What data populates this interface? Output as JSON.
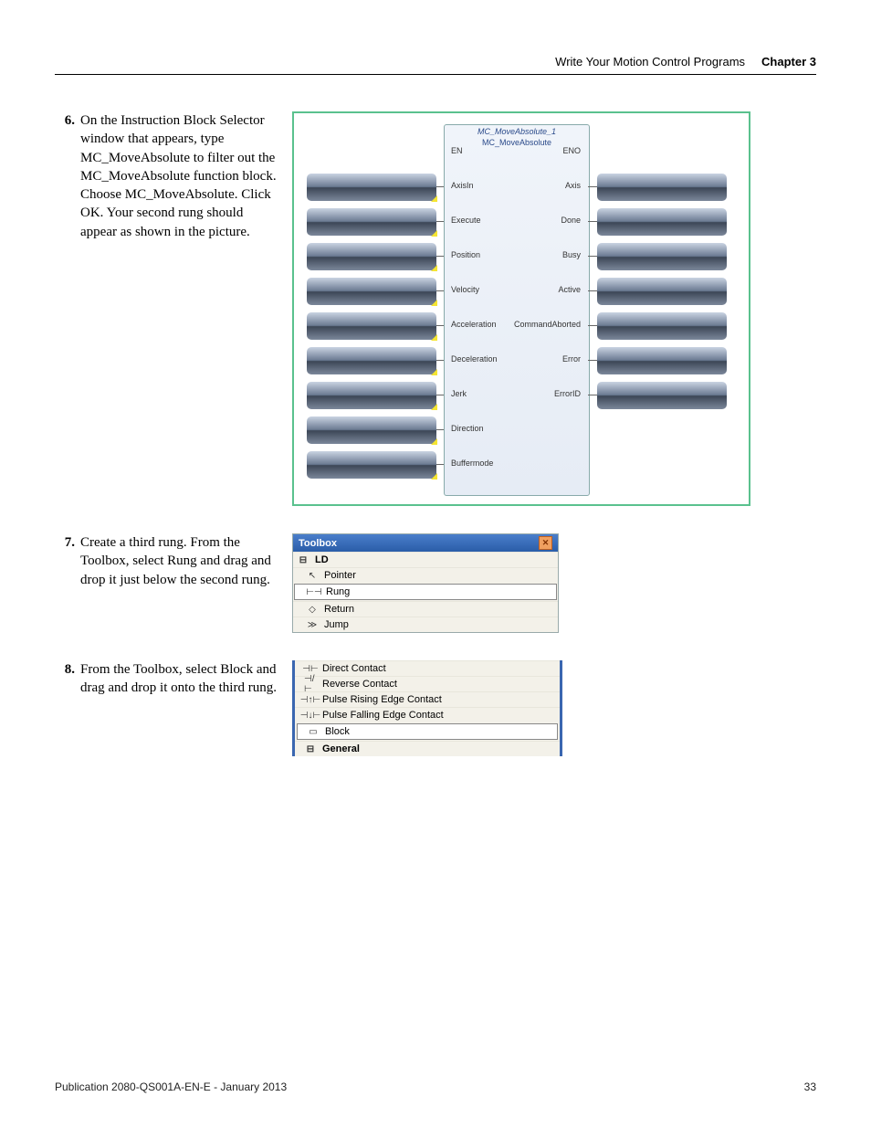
{
  "header": {
    "section": "Write Your Motion Control Programs",
    "chapter": "Chapter 3"
  },
  "steps": {
    "s6": {
      "num": "6.",
      "text": "On the Instruction Block Selector window that appears, type MC_MoveAbsolute to filter out the MC_MoveAbsolute function block. Choose MC_MoveAbsolute. Click OK. Your second rung should appear as shown in the picture."
    },
    "s7": {
      "num": "7.",
      "text": "Create a third rung. From the Toolbox, select Rung and drag and drop it just below the second rung."
    },
    "s8": {
      "num": "8.",
      "text": "From the Toolbox, select Block and drag and drop it onto the third rung."
    }
  },
  "function_block": {
    "title_instance": "MC_MoveAbsolute_1",
    "title_type": "MC_MoveAbsolute",
    "left_ports": [
      "EN",
      "AxisIn",
      "Execute",
      "Position",
      "Velocity",
      "Acceleration",
      "Deceleration",
      "Jerk",
      "Direction",
      "Buffermode"
    ],
    "right_ports": [
      "ENO",
      "Axis",
      "Done",
      "Busy",
      "Active",
      "CommandAborted",
      "Error",
      "ErrorID"
    ]
  },
  "toolbox": {
    "title": "Toolbox",
    "group": "LD",
    "items": [
      "Pointer",
      "Rung",
      "Return",
      "Jump"
    ],
    "selected": "Rung"
  },
  "blocklist": {
    "items": [
      "Direct Contact",
      "Reverse Contact",
      "Pulse Rising Edge Contact",
      "Pulse Falling Edge Contact",
      "Block",
      "General"
    ],
    "selected": "Block"
  },
  "footer": {
    "pub": "Publication 2080-QS001A-EN-E - January 2013",
    "page": "33"
  }
}
